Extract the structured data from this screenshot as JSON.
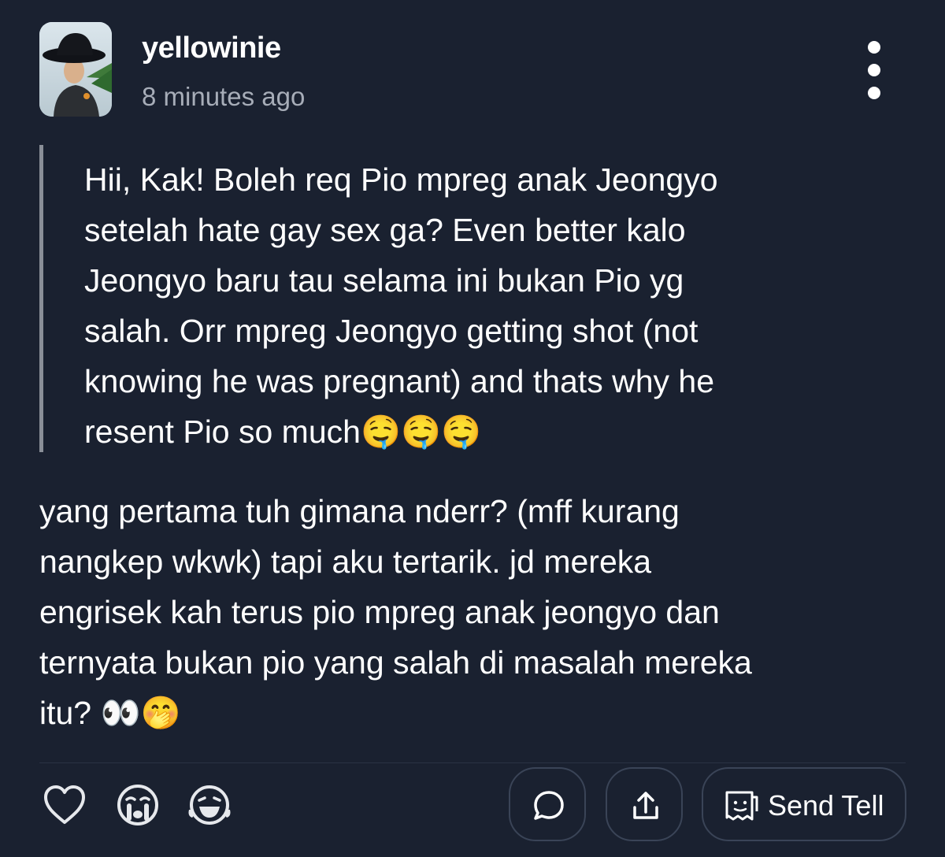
{
  "post": {
    "username": "yellowinie",
    "timestamp": "8 minutes ago"
  },
  "question": {
    "text": "Hii, Kak! Boleh req Pio mpreg anak Jeongyo\nsetelah hate gay sex ga? Even better kalo\nJeongyo baru tau selama ini bukan Pio yg\nsalah. Orr  mpreg Jeongyo getting shot (not\nknowing he was pregnant) and thats why he\nresent Pio so much🤤🤤🤤"
  },
  "answer": {
    "text": "yang pertama tuh gimana nderr? (mff kurang\nnangkep wkwk) tapi aku tertarik. jd mereka\nengrisek kah terus pio mpreg anak jeongyo dan\nternyata bukan pio yang salah di masalah mereka\nitu? 👀🤭"
  },
  "actions": {
    "send_tell_label": "Send Tell",
    "icons": [
      "heart-icon",
      "crying-face-icon",
      "laughing-face-icon",
      "comment-icon",
      "share-icon",
      "send-tell-icon",
      "more-vertical-icon"
    ]
  },
  "colors": {
    "background": "#1a2130",
    "text": "#ffffff",
    "muted": "#a7adb8",
    "quote_bar": "#8a8f98",
    "pill_border": "#3a4457"
  }
}
